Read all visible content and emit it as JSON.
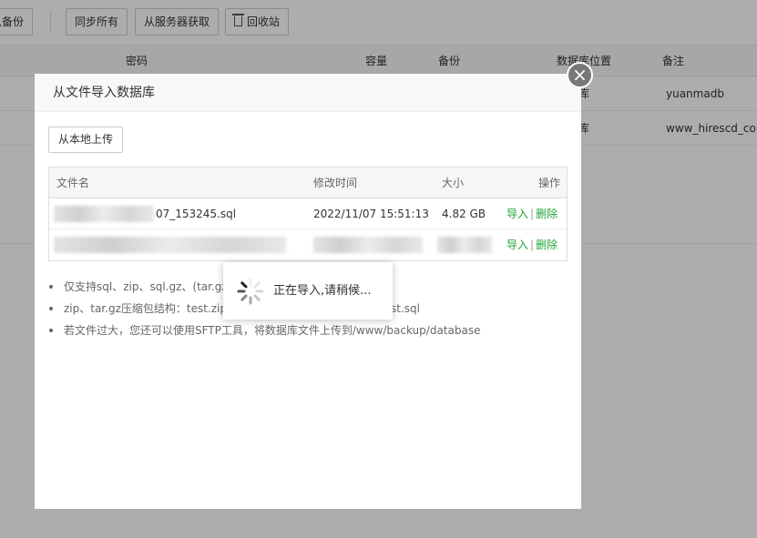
{
  "toolbar": {
    "import_backup_label": "导入备份",
    "sync_all_label": "同步所有",
    "fetch_from_server_label": "从服务器获取",
    "recycle_bin_label": "回收站"
  },
  "background_table": {
    "columns": {
      "password": "密码",
      "capacity": "容量",
      "backup": "备份",
      "db_location": "数据库位置",
      "remark": "备注"
    },
    "rows": [
      {
        "location": "数据库",
        "remark": "yuanmadb"
      },
      {
        "location": "数据库",
        "remark": "www_hirescd_com"
      }
    ]
  },
  "modal": {
    "title": "从文件导入数据库",
    "close_glyph": "×",
    "upload_label": "从本地上传",
    "table": {
      "columns": {
        "filename": "文件名",
        "modified": "修改时间",
        "size": "大小",
        "actions": "操作"
      },
      "rows": [
        {
          "filename": "07_153245.sql",
          "modified": "2022/11/07 15:51:13",
          "size": "4.82 GB",
          "import": "导入",
          "sep": "|",
          "delete": "删除"
        },
        {
          "filename": "",
          "modified": "",
          "size": "",
          "import": "导入",
          "sep": "|",
          "delete": "删除"
        }
      ]
    },
    "notes": [
      "仅支持sql、zip、sql.gz、(tar.gz",
      "zip、tar.gz压缩包结构：test.zip",
      "若文件过大，您还可以使用SFTP工具，将数据库文件上传到/www/backup/database"
    ],
    "note_fragment": "st.sql"
  },
  "loading": {
    "text": "正在导入,请稍候..."
  },
  "colors": {
    "accent_green": "#20a53a",
    "overlay": "rgba(0,0,0,0.32)"
  }
}
